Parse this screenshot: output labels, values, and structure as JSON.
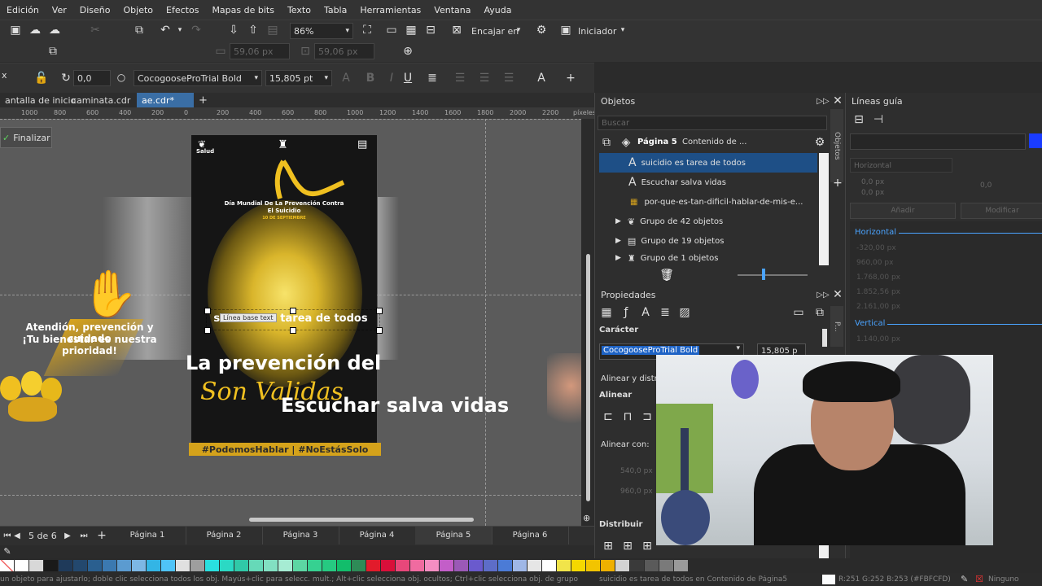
{
  "menu": [
    "Edición",
    "Ver",
    "Diseño",
    "Objeto",
    "Efectos",
    "Mapas de bits",
    "Texto",
    "Tabla",
    "Herramientas",
    "Ventana",
    "Ayuda"
  ],
  "toolbar": {
    "zoom": "86%",
    "fit_label": "Encajar en",
    "launcher_label": "Iniciador"
  },
  "toolbar2": {
    "w": "59,06 px",
    "h": "59,06 px"
  },
  "textbar": {
    "x_label": "x",
    "angle": "0,0",
    "font": "CocogooseProTrial Bold",
    "size": "15,805 pt"
  },
  "doc_tabs": [
    "antalla de inicio",
    "caminata.cdr",
    "ae.cdr*"
  ],
  "ruler": {
    "ticks": [
      "1000",
      "800",
      "600",
      "400",
      "200",
      "0",
      "200",
      "400",
      "600",
      "800",
      "1000",
      "1200",
      "1400",
      "1600",
      "1800",
      "2000",
      "2200"
    ],
    "unit": "píxeles"
  },
  "canvas": {
    "finalize": "Finalizar",
    "poster_salud": "Salud",
    "poster_title": "Día Mundial De La Prevención Contra El Suicidio",
    "poster_date": "10 DE SEPTIEMBRE",
    "selected_text": "suicidio es tarea de todos",
    "tooltip": "Línea base text",
    "big_text": "La prevención del",
    "script_text": "Son Validas",
    "escuchar": "Escuchar salva vidas",
    "left_text1": "Atendión, prevención y cuidado",
    "left_text2": "¡Tu bienestar es nuestra prioridad!",
    "banner": "#PodemosHablar | #NoEstásSolo"
  },
  "pages": {
    "counter": "5 de 6",
    "items": [
      "Página 1",
      "Página 2",
      "Página 3",
      "Página 4",
      "Página 5",
      "Página 6"
    ],
    "active": 4
  },
  "objects_panel": {
    "title": "Objetos",
    "search_placeholder": "Buscar",
    "page_label": "Página 5",
    "content_label": "Contenido de ...",
    "rows": [
      "suicidio es tarea de todos",
      "Escuchar salva vidas",
      "por-que-es-tan-dificil-hablar-de-mis-e...",
      "Grupo de 42 objetos",
      "Grupo de 19 objetos",
      "Grupo de 1 objetos"
    ],
    "side_tab": "Objetos"
  },
  "properties_panel": {
    "title": "Propiedades",
    "section": "Carácter",
    "font": "CocogooseProTrial Bold",
    "size": "15,805 p",
    "align_dist": "Alinear y distrib",
    "align": "Alinear",
    "align_with": "Alinear con:",
    "x": "540,0 px",
    "y": "960,0 px",
    "distribute": "Distribuir",
    "side_tab": "P..."
  },
  "guides_panel": {
    "title": "Líneas guía",
    "label": "Horizontal",
    "x1": "0,0 px",
    "y1": "0,0 px",
    "angle": "0,0",
    "add": "Añadir",
    "modify": "Modificar",
    "horizontal_header": "Horizontal",
    "horizontal_values": [
      "-320,00 px",
      "960,00 px",
      "1.768,00 px",
      "1.852,56 px",
      "2.161,00 px"
    ],
    "vertical_header": "Vertical",
    "vertical_values": [
      "1.140,00 px"
    ]
  },
  "status": {
    "hint": "un objeto para ajustarlo; doble clic selecciona todos los obj. Mayús+clic para selecc. mult.; Alt+clic selecciona obj. ocultos; Ctrl+clic selecciona obj. de grupo",
    "selected": "suicidio es tarea de todos en Contenido de Página5",
    "color": "R:251 G:252 B:253 (#FBFCFD)",
    "none": "Ninguno"
  },
  "palette_colors": [
    "#ffffff",
    "#d8d8d8",
    "#1a1a1a",
    "#1f3a5a",
    "#23486e",
    "#2a5f8f",
    "#3b79b0",
    "#5b9bd0",
    "#7db7e4",
    "#33b5e5",
    "#4fc3f7",
    "#e0e0e0",
    "#9e9e9e",
    "#29e0e0",
    "#2bd9c4",
    "#30c9a8",
    "#66d9b8",
    "#82e0c2",
    "#a6ecd3",
    "#5cd6a3",
    "#36d191",
    "#26c981",
    "#12bd6b",
    "#2e8b57",
    "#e21b2b",
    "#d90f3a",
    "#e8477a",
    "#f06ba0",
    "#f58ec2",
    "#c35ec8",
    "#9b59b6",
    "#6a5acd",
    "#5d6dc8",
    "#4b7bd6",
    "#9fb7e6",
    "#e6e6e6",
    "#ffffff",
    "#f1e44a",
    "#f5d800",
    "#f2c400",
    "#efb000",
    "#d3d3d3",
    "#3a3a3a",
    "#5a5a5a",
    "#7a7a7a",
    "#9a9a9a"
  ]
}
